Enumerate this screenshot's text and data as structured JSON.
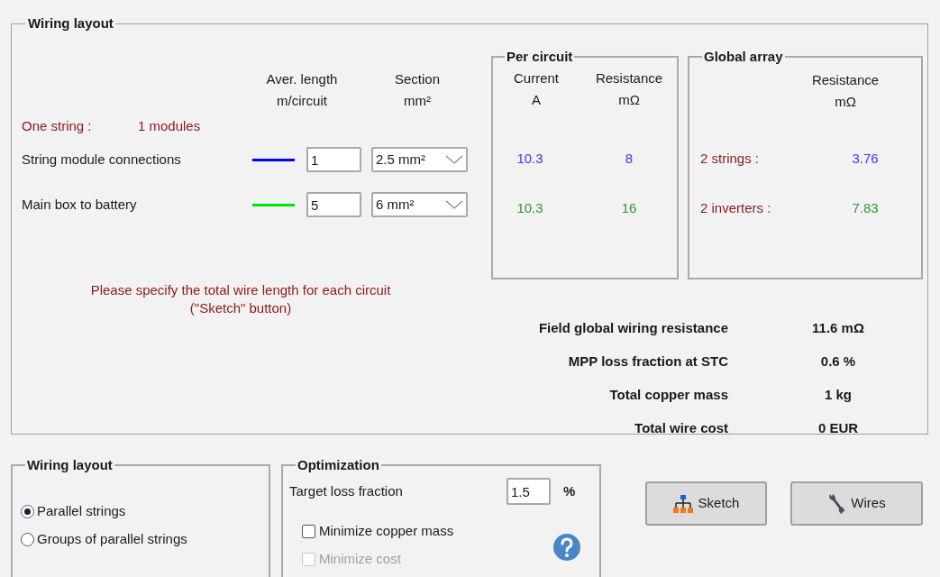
{
  "wiring_layout": {
    "title": "Wiring layout",
    "headers": [
      {
        "lines": [
          "Aver. length",
          "m/circuit"
        ]
      },
      {
        "lines": [
          "Section",
          "mm²"
        ]
      }
    ],
    "one_string": {
      "label": "One string :",
      "value": "1 modules"
    },
    "circuits": [
      {
        "name": "String module connections",
        "color": "#0000ff",
        "length": "1",
        "section": "2.5 mm²"
      },
      {
        "name": "Main box to battery",
        "color": "#00e600",
        "length": "5",
        "section": "6 mm²"
      }
    ],
    "note": [
      "Please specify the total wire length for each circuit",
      "(\"Sketch\" button)"
    ],
    "per_circuit": {
      "title": "Per circuit",
      "headers": [
        {
          "lines": [
            "Current",
            "A"
          ]
        },
        {
          "lines": [
            "Resistance",
            "mΩ"
          ]
        }
      ],
      "rows": [
        {
          "current": "10.3",
          "resistance": "8",
          "color": "#3a3aff"
        },
        {
          "current": "10.3",
          "resistance": "16",
          "color": "#2f9a2f"
        }
      ]
    },
    "global_array": {
      "title": "Global array",
      "header": {
        "lines": [
          "Resistance",
          "mΩ"
        ]
      },
      "rows": [
        {
          "label": "2 strings :",
          "value": "3.76",
          "color": "#3a3aff"
        },
        {
          "label": "2 inverters :",
          "value": "7.83",
          "color": "#2f9a2f"
        }
      ]
    },
    "summary": [
      {
        "label": "Field global wiring resistance",
        "value": "11.6 mΩ"
      },
      {
        "label": "MPP loss fraction at STC",
        "value": "0.6 %"
      },
      {
        "label": "Total copper mass",
        "value": "1 kg"
      },
      {
        "label": "Total wire cost",
        "value": "0 EUR"
      }
    ]
  },
  "layout_options": {
    "title": "Wiring layout",
    "options": [
      {
        "label": "Parallel strings",
        "selected": true
      },
      {
        "label": "Groups of parallel strings",
        "selected": false
      }
    ]
  },
  "optimization": {
    "title": "Optimization",
    "target_label": "Target loss fraction",
    "target_value": "1.5",
    "unit": "%",
    "checkboxes": [
      {
        "label": "Minimize copper mass",
        "checked": false,
        "disabled": false
      },
      {
        "label": "Minimize cost",
        "checked": false,
        "disabled": true
      }
    ]
  },
  "buttons": [
    {
      "label": "Sketch",
      "kind": "sketch"
    },
    {
      "label": "Wires",
      "kind": "wires"
    }
  ]
}
